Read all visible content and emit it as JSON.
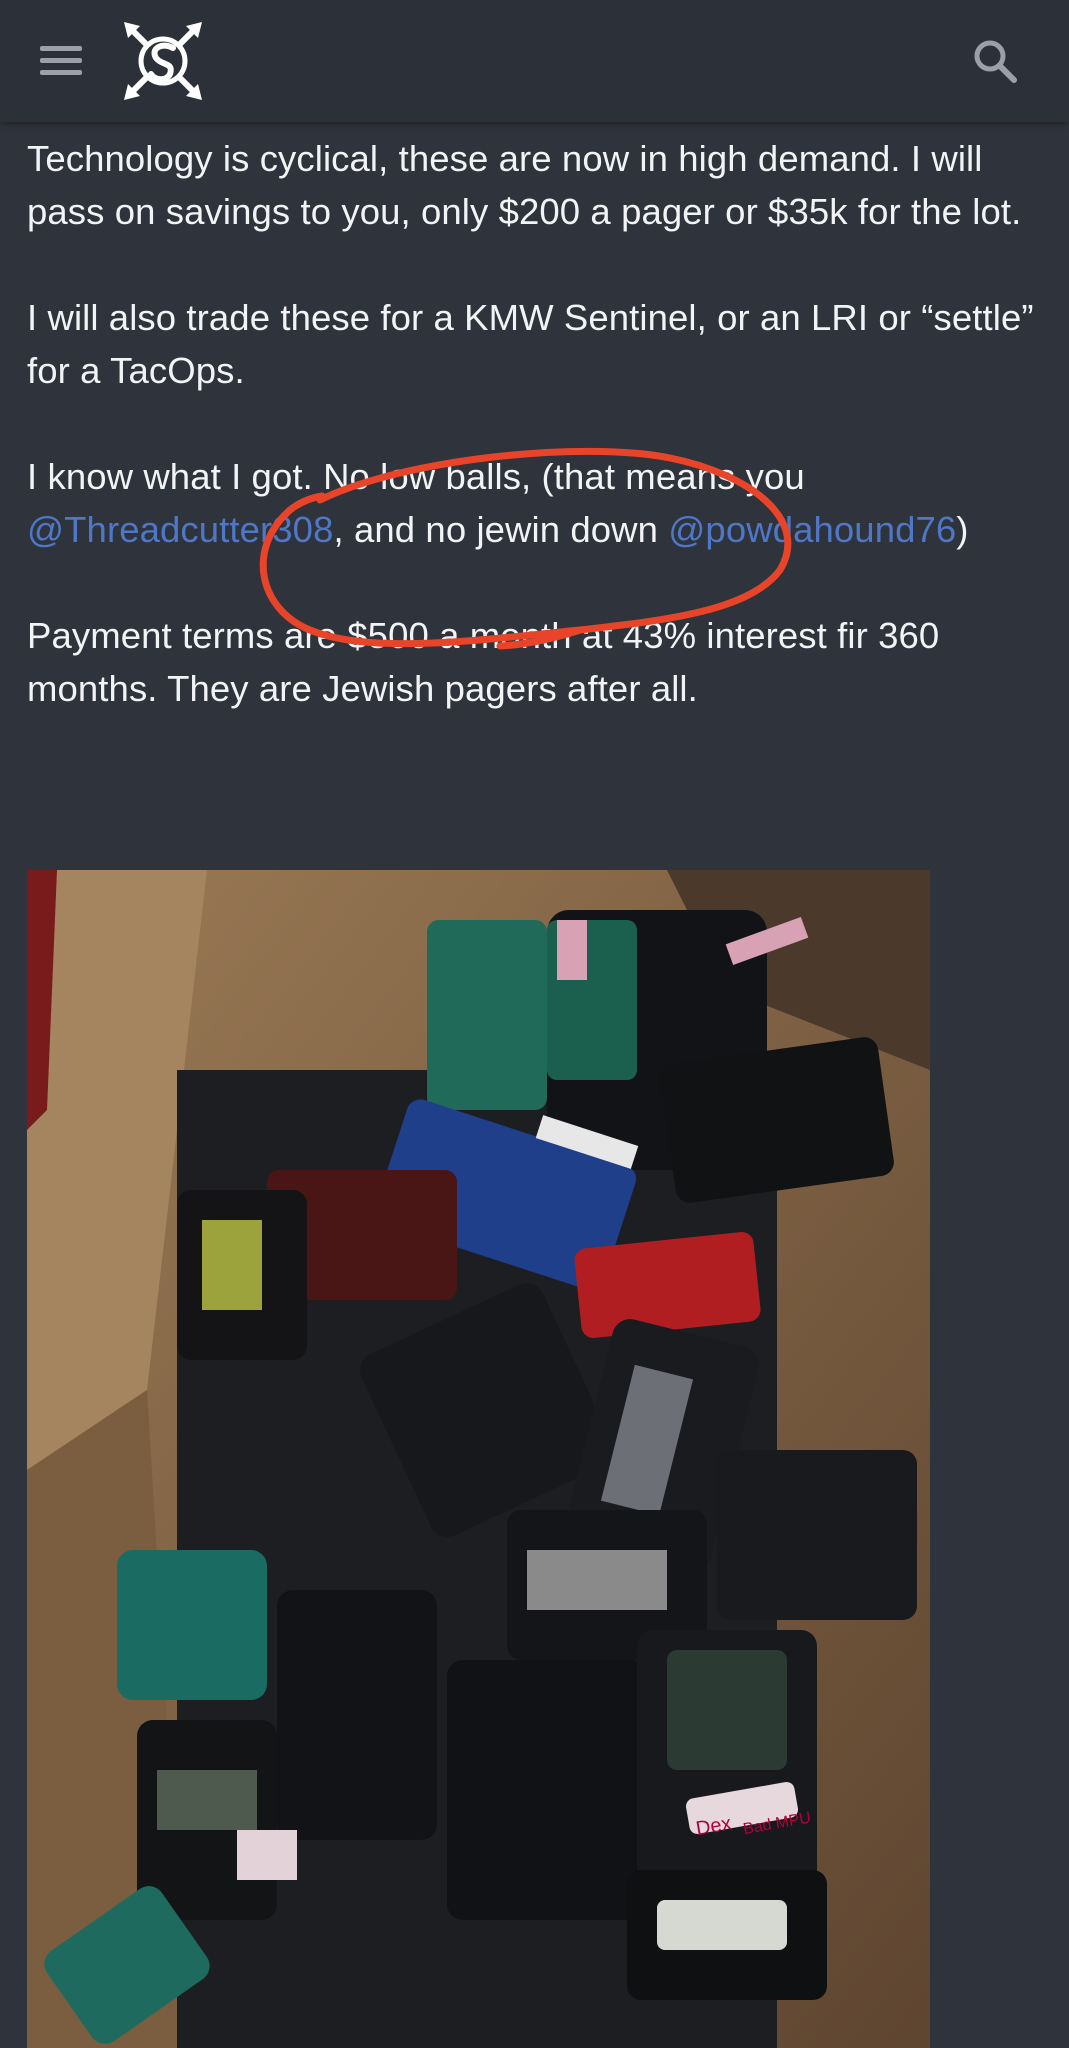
{
  "header": {
    "menu_icon": "hamburger-menu-icon",
    "logo_icon": "site-logo-crossed-arrows-icon",
    "search_icon": "search-icon"
  },
  "post": {
    "p1": "Technology is cyclical, these are now in high demand. I will pass on savings to you, only $200 a pager or $35k for the lot.",
    "p2": "I will also trade these for a KMW Sentinel, or an LRI or “settle” for a TacOps.",
    "p3_a": "I know what I got. No low balls, (that means you ",
    "mention1": "@Threadcutter308",
    "p3_b": ", and no jewin down ",
    "mention2": "@powdahound76",
    "p3_c": ")",
    "p4": "Payment terms are $500 a month at 43% interest fir 360 months. They are Jewish pagers after all."
  },
  "image": {
    "caption": "",
    "label_dex": "Dex",
    "label_2": "Bad MPU"
  },
  "colors": {
    "background": "#2f333b",
    "topbar": "#2c3038",
    "text": "#f2f3f5",
    "mention": "#4f77c8",
    "annotation": "#e8442a"
  }
}
